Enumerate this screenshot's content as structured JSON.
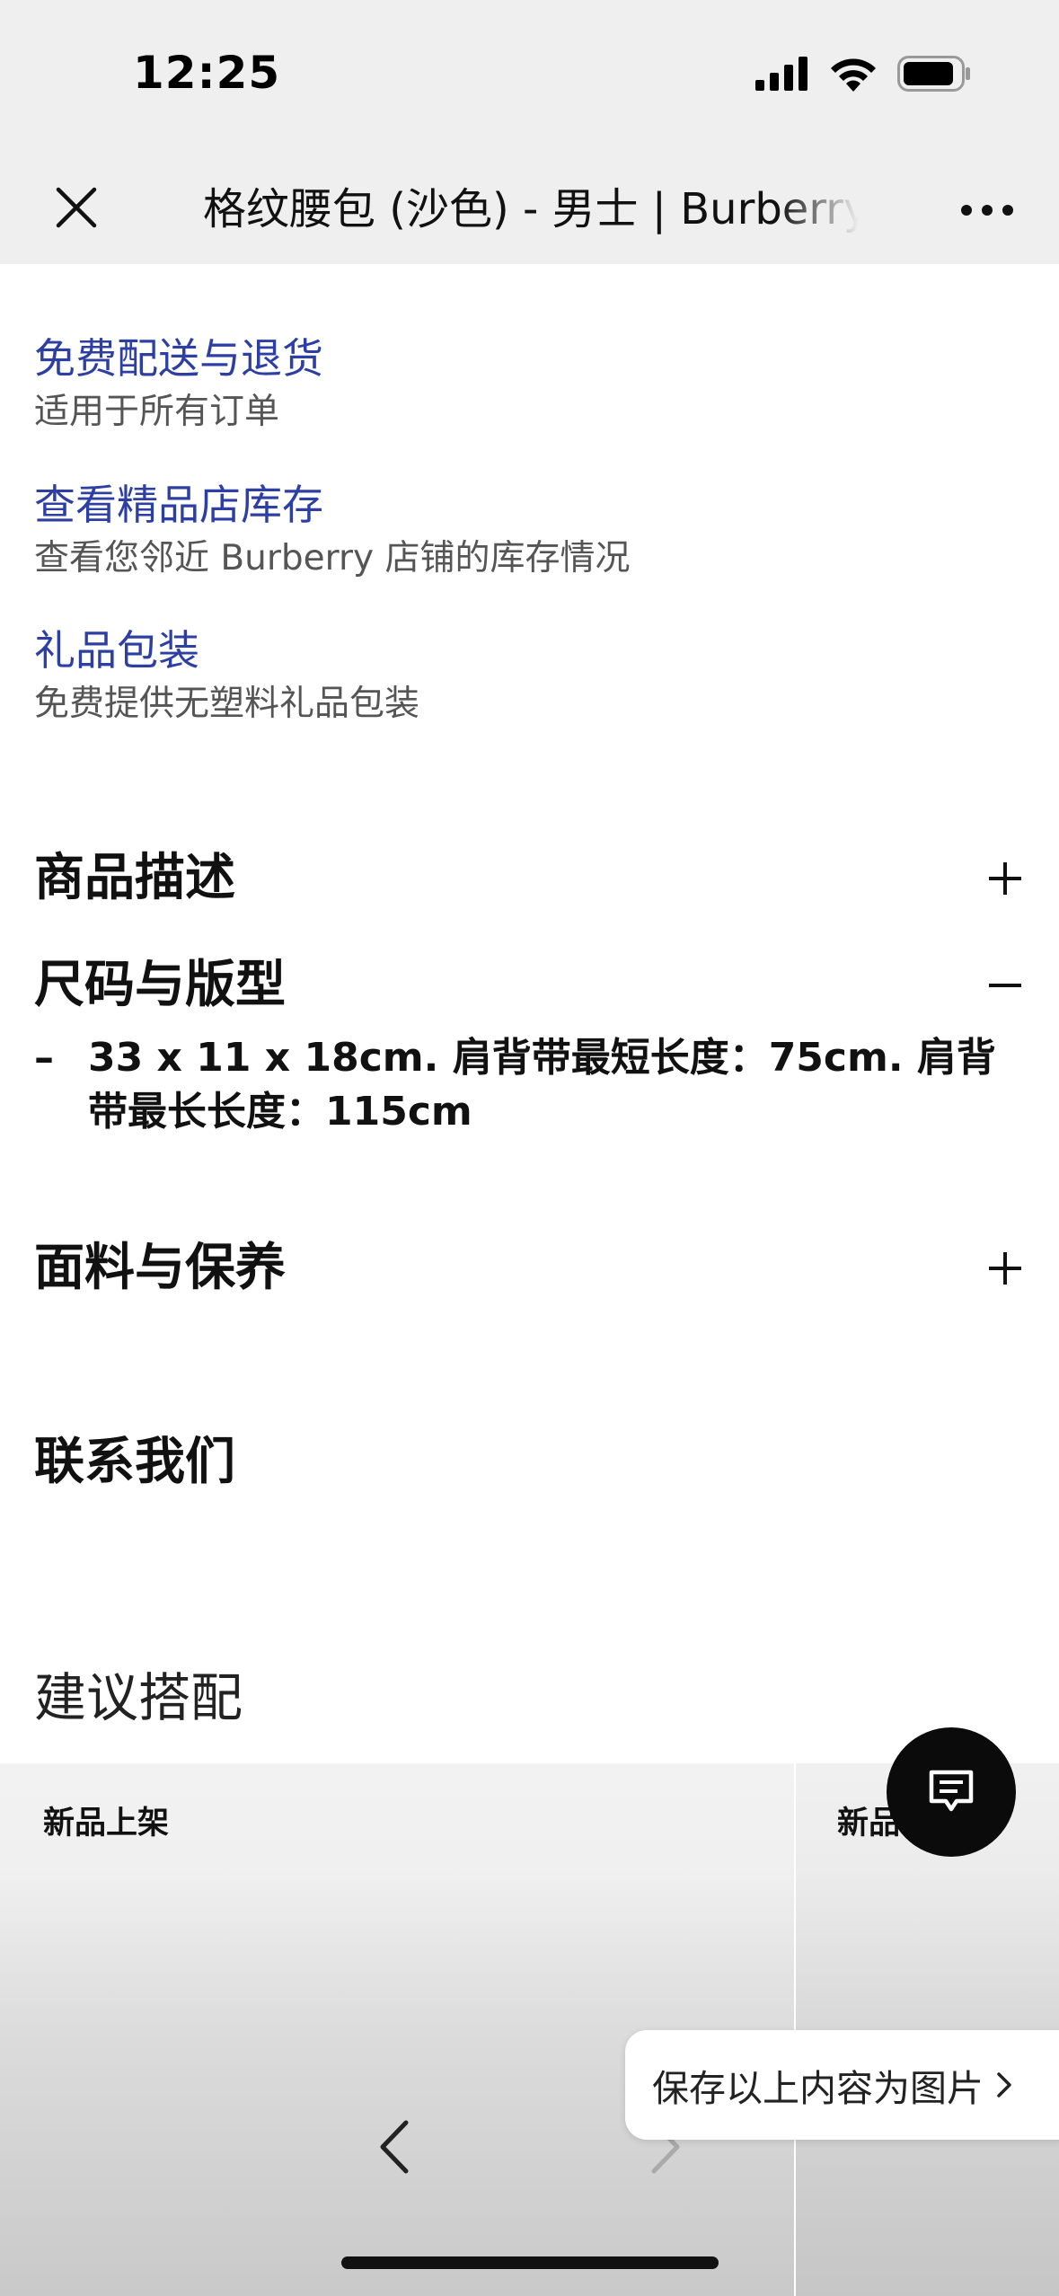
{
  "status_bar": {
    "time": "12:25"
  },
  "nav": {
    "title": "格纹腰包 (沙色) - 男士 | Burberry"
  },
  "services": [
    {
      "title": "免费配送与退货",
      "subtitle": "适用于所有订单"
    },
    {
      "title": "查看精品店库存",
      "subtitle": "查看您邻近 Burberry 店铺的库存情况"
    },
    {
      "title": "礼品包装",
      "subtitle": "免费提供无塑料礼品包装"
    }
  ],
  "sections": {
    "description": {
      "label": "商品描述",
      "toggle": "+"
    },
    "size_fit": {
      "label": "尺码与版型",
      "toggle": "−",
      "detail_dash": "–",
      "detail": "33 x 11 x 18cm. 肩背带最短长度：75cm. 肩背带最长长度：115cm"
    },
    "materials": {
      "label": "面料与保养",
      "toggle": "+"
    },
    "contact": {
      "label": "联系我们"
    }
  },
  "suggestions": {
    "title": "建议搭配",
    "cards": [
      {
        "badge": "新品上架"
      },
      {
        "badge": "新品"
      }
    ]
  },
  "save_prompt": {
    "label": "保存以上内容为图片"
  },
  "icons": {
    "close": "close-icon",
    "more": "more-icon",
    "chat": "chat-icon",
    "back": "back-arrow-icon",
    "forward": "forward-arrow-icon"
  }
}
